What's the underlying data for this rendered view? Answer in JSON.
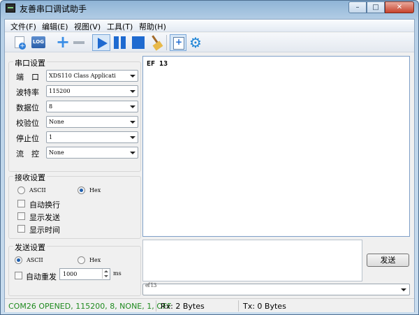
{
  "window": {
    "title": "友善串口调试助手",
    "buttons": {
      "minimize": "–",
      "maximize": "□",
      "close": "✕"
    }
  },
  "menu": [
    "文件(F)",
    "编辑(E)",
    "视图(V)",
    "工具(T)",
    "帮助(H)"
  ],
  "toolbar": {
    "log_label": "LOG",
    "icons": [
      "new-document-icon",
      "log-icon",
      "plus-icon",
      "minus-icon",
      "play-icon",
      "pause-icon",
      "stop-icon",
      "broom-icon",
      "add-window-icon",
      "gear-icon"
    ]
  },
  "serial_settings": {
    "title": "串口设置",
    "fields": [
      {
        "label": "端　口",
        "value": "XDS110 Class Applicati"
      },
      {
        "label": "波特率",
        "value": "115200"
      },
      {
        "label": "数据位",
        "value": "8"
      },
      {
        "label": "校验位",
        "value": "None"
      },
      {
        "label": "停止位",
        "value": "1"
      },
      {
        "label": "流　控",
        "value": "None"
      }
    ]
  },
  "receive_settings": {
    "title": "接收设置",
    "mode_ascii": "ASCII",
    "mode_hex": "Hex",
    "selected_mode": "Hex",
    "options": [
      "自动换行",
      "显示发送",
      "显示时间"
    ]
  },
  "send_settings": {
    "title": "发送设置",
    "mode_ascii": "ASCII",
    "mode_hex": "Hex",
    "selected_mode": "ASCII",
    "auto_resend_label": "自动重发",
    "interval": "1000",
    "interval_unit": "ms"
  },
  "receive_area": {
    "content": "EF 13"
  },
  "send_area": {
    "content": ""
  },
  "send_button": "发送",
  "history": {
    "value": "ef 13"
  },
  "status": {
    "port": "COM26 OPENED, 115200, 8, NONE, 1, OFF",
    "rx": "Rx: 2 Bytes",
    "tx": "Tx: 0 Bytes"
  },
  "colors": {
    "status_green": "#1f8a1f",
    "accent_blue": "#1e6ad0"
  }
}
